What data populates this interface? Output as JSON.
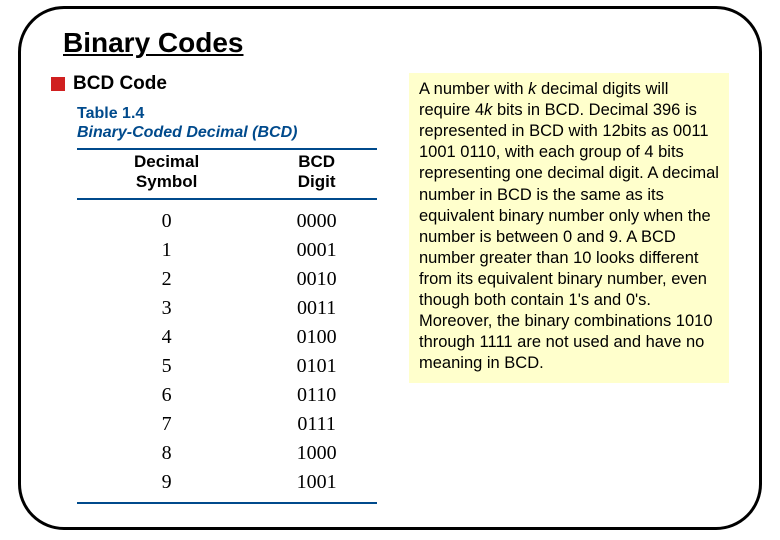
{
  "title": "Binary Codes",
  "subhead": "BCD Code",
  "table": {
    "caption_label": "Table 1.4",
    "caption_title": "Binary-Coded Decimal (BCD)",
    "headers": {
      "col1a": "Decimal",
      "col1b": "Symbol",
      "col2a": "BCD",
      "col2b": "Digit"
    },
    "rows": [
      {
        "dec": "0",
        "bcd": "0000"
      },
      {
        "dec": "1",
        "bcd": "0001"
      },
      {
        "dec": "2",
        "bcd": "0010"
      },
      {
        "dec": "3",
        "bcd": "0011"
      },
      {
        "dec": "4",
        "bcd": "0100"
      },
      {
        "dec": "5",
        "bcd": "0101"
      },
      {
        "dec": "6",
        "bcd": "0110"
      },
      {
        "dec": "7",
        "bcd": "0111"
      },
      {
        "dec": "8",
        "bcd": "1000"
      },
      {
        "dec": "9",
        "bcd": "1001"
      }
    ]
  },
  "para": {
    "s1a": "A number with ",
    "k1": "k",
    "s1b": " decimal digits will require 4",
    "k2": "k",
    "s1c": " bits in BCD. Decimal 396 is represented in BCD with 12bits as 0011 1001 0110, with each group of 4 bits representing one decimal digit. A decimal number in BCD is the same as its equivalent binary number only when the number is between 0 and 9. A BCD number greater than 10 looks different from its equivalent binary number, even though both contain 1's and 0's. Moreover, the binary combinations 1010 through 1111 are not used and have no meaning in BCD."
  }
}
